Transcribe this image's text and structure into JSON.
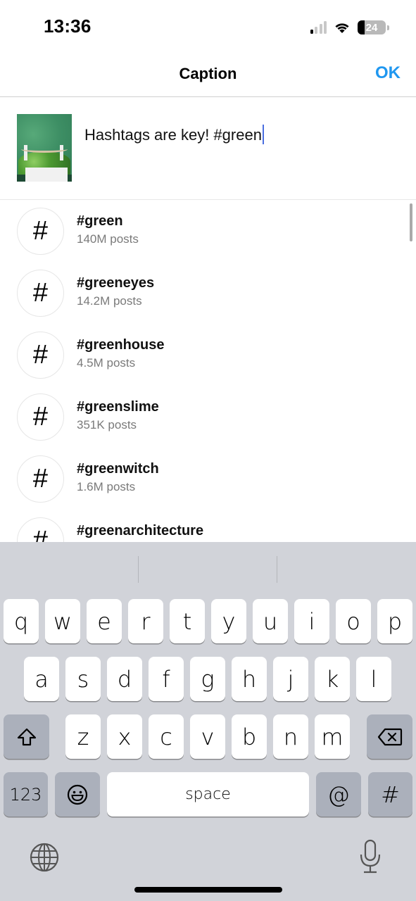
{
  "status_bar": {
    "time": "13:36",
    "signal_bars_active": 1,
    "signal_bars_total": 4,
    "wifi_icon": "wifi-icon",
    "battery_percent": 24
  },
  "nav": {
    "title": "Caption",
    "ok_label": "OK",
    "ok_color": "#1f97f0"
  },
  "composer": {
    "thumbnail_alt": "green plant basket photo",
    "caption_text": "Hashtags are key! #green",
    "caret_color": "#4a6ee0"
  },
  "suggestions": [
    {
      "icon": "#",
      "tag": "#green",
      "count": "140M posts"
    },
    {
      "icon": "#",
      "tag": "#greeneyes",
      "count": "14.2M posts"
    },
    {
      "icon": "#",
      "tag": "#greenhouse",
      "count": "4.5M posts"
    },
    {
      "icon": "#",
      "tag": "#greenslime",
      "count": "351K posts"
    },
    {
      "icon": "#",
      "tag": "#greenwitch",
      "count": "1.6M posts"
    },
    {
      "icon": "#",
      "tag": "#greenarchitecture",
      "count": ""
    }
  ],
  "keyboard": {
    "row1": [
      "q",
      "w",
      "e",
      "r",
      "t",
      "y",
      "u",
      "i",
      "o",
      "p"
    ],
    "row2": [
      "a",
      "s",
      "d",
      "f",
      "g",
      "h",
      "j",
      "k",
      "l"
    ],
    "row3": [
      "z",
      "x",
      "c",
      "v",
      "b",
      "n",
      "m"
    ],
    "shift_icon": "shift-icon",
    "backspace_icon": "backspace-icon",
    "numbers_label": "123",
    "emoji_icon": "emoji-icon",
    "space_label": "space",
    "at_label": "@",
    "hash_label": "#",
    "globe_icon": "globe-icon",
    "mic_icon": "microphone-icon"
  }
}
